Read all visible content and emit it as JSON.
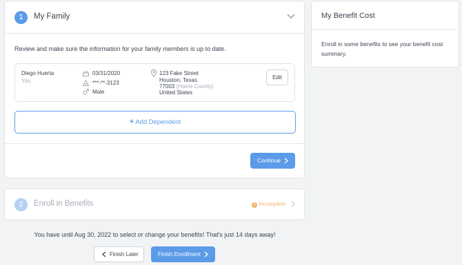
{
  "step1": {
    "number": "1",
    "title": "My Family",
    "intro": "Review and make sure the information for your family members is up to date.",
    "member": {
      "name": "Diego Huerta",
      "relation": "You",
      "dob": "03/31/2020",
      "ssn": "***-**-3123",
      "gender": "Male",
      "address_line1": "123 Fake Street",
      "address_line2": "Houston, Texas",
      "zip": "77003",
      "county": "(Harris County)",
      "country": "United States",
      "edit_label": "Edit"
    },
    "add_dependent_label": "Add Dependent",
    "continue_label": "Continue"
  },
  "step2": {
    "number": "2",
    "title": "Enroll in Benefits",
    "status": "Incomplete"
  },
  "cost": {
    "title": "My Benefit Cost",
    "text": "Enroll in some benefits to see your benefit cost summary."
  },
  "footer": {
    "deadline": "You have until Aug 30, 2022 to select or change your benefits! That's just 14 days away!",
    "finish_later_label": "Finish Later",
    "finish_enrollment_label": "Finish Enrollment"
  },
  "colors": {
    "accent": "#5b9be8",
    "warning": "#f0b56a",
    "muted": "#a6adb7"
  }
}
